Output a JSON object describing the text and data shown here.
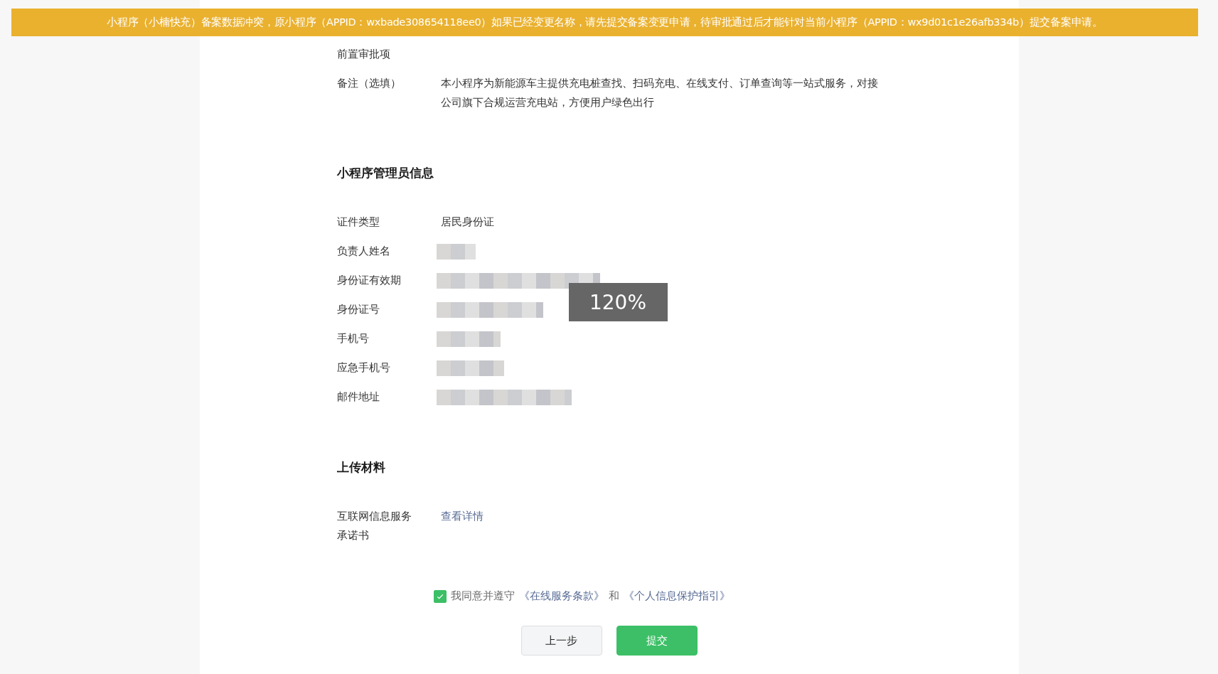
{
  "banner": {
    "text": "小程序（小楠快充）备案数据冲突，原小程序（APPID：wxbade308654118ee0）如果已经变更名称，请先提交备案变更申请，待审批通过后才能针对当前小程序（APPID：wx9d01c1e26afb334b）提交备案申请。"
  },
  "service_rows": [
    {
      "label": "前置审批项",
      "kind": "label_only"
    },
    {
      "label": "备注（选填）",
      "value": "本小程序为新能源车主提供充电桩查找、扫码充电、在线支付、订单查询等一站式服务，对接公司旗下合规运营充电站，方便用户绿色出行",
      "kind": "text"
    }
  ],
  "admin_section": {
    "title": "小程序管理员信息",
    "rows": [
      {
        "label": "证件类型",
        "value": "居民身份证",
        "kind": "text"
      },
      {
        "label": "负责人姓名",
        "kind": "redacted"
      },
      {
        "label": "身份证有效期",
        "kind": "redacted"
      },
      {
        "label": "身份证号",
        "kind": "redacted"
      },
      {
        "label": "手机号",
        "kind": "redacted"
      },
      {
        "label": "应急手机号",
        "kind": "redacted"
      },
      {
        "label": "邮件地址",
        "kind": "redacted"
      }
    ]
  },
  "upload_section": {
    "title": "上传材料",
    "rows": [
      {
        "label": "互联网信息服务承诺书",
        "value": "查看详情",
        "kind": "link"
      }
    ]
  },
  "agreement": {
    "checked": true,
    "text": "我同意并遵守",
    "link_1": "《在线服务条款》",
    "conjunction": "和",
    "link_2": "《个人信息保护指引》"
  },
  "buttons": [
    {
      "label": "上一步",
      "kind": "secondary"
    },
    {
      "label": "提交",
      "kind": "primary"
    }
  ],
  "zoom_indicator": {
    "text": "120%"
  }
}
